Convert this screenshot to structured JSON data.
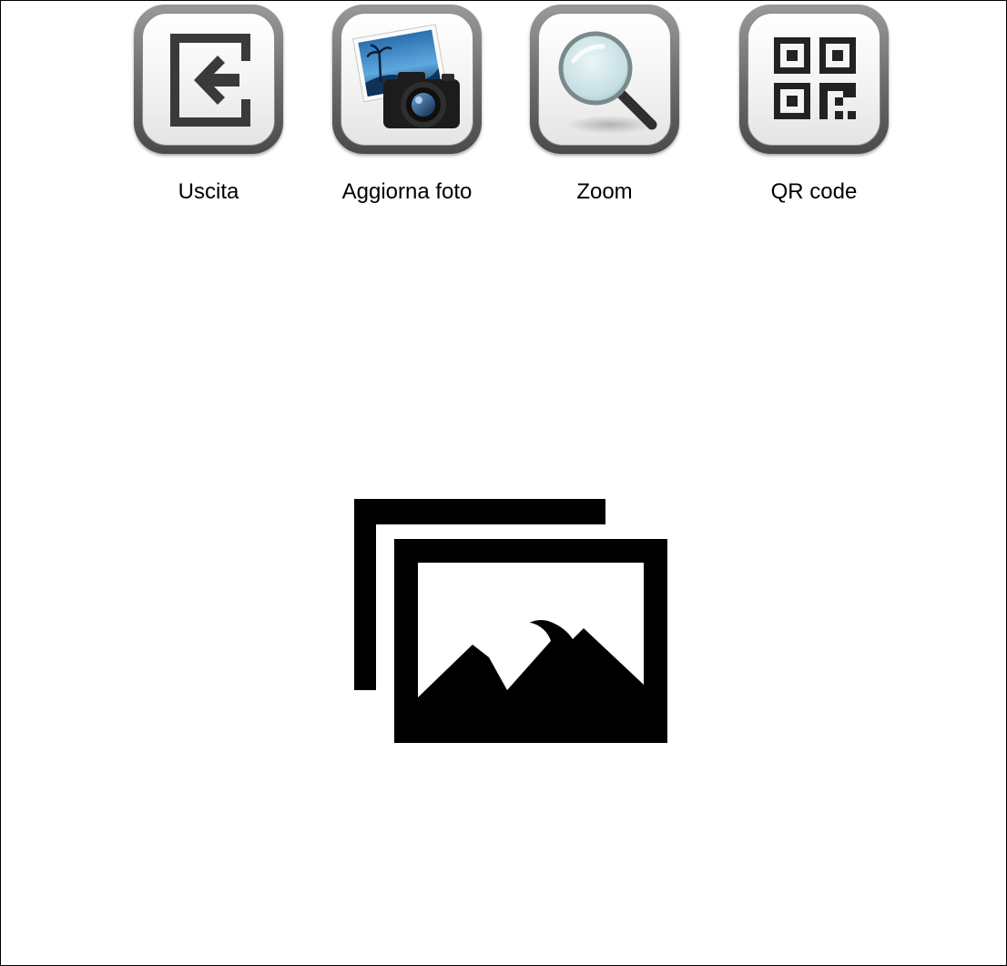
{
  "toolbar": {
    "buttons": [
      {
        "label": "Uscita",
        "icon": "exit-icon"
      },
      {
        "label": "Aggiorna foto",
        "icon": "camera-photo-icon"
      },
      {
        "label": "Zoom",
        "icon": "magnifier-icon"
      },
      {
        "label": "QR code",
        "icon": "qr-code-icon"
      }
    ]
  },
  "main": {
    "placeholder_icon": "image-gallery-icon"
  },
  "colors": {
    "background": "#ffffff",
    "border": "#000000",
    "tile_frame": "#6a6a6a",
    "icon_dark": "#333333"
  }
}
